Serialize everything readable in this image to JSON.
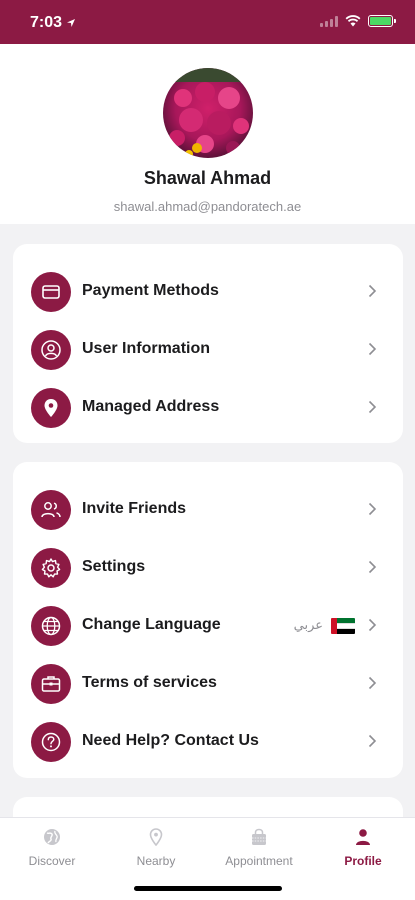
{
  "status_bar": {
    "time": "7:03"
  },
  "profile": {
    "name": "Shawal Ahmad",
    "email": "shawal.ahmad@pandoratech.ae"
  },
  "menu_group_1": [
    {
      "label": "Payment Methods",
      "icon": "credit-card-icon"
    },
    {
      "label": "User Information",
      "icon": "user-icon"
    },
    {
      "label": "Managed Address",
      "icon": "location-pin-icon"
    }
  ],
  "menu_group_2": [
    {
      "label": "Invite Friends",
      "icon": "users-icon"
    },
    {
      "label": "Settings",
      "icon": "gear-icon"
    },
    {
      "label": "Change Language",
      "icon": "globe-icon",
      "value": "عربي",
      "flag": "uae-flag-icon"
    },
    {
      "label": "Terms of services",
      "icon": "briefcase-icon"
    },
    {
      "label": "Need Help? Contact Us",
      "icon": "help-icon"
    }
  ],
  "tabs": [
    {
      "label": "Discover",
      "icon": "globe-icon",
      "active": false
    },
    {
      "label": "Nearby",
      "icon": "location-pin-icon",
      "active": false
    },
    {
      "label": "Appointment",
      "icon": "shopping-bag-icon",
      "active": false
    },
    {
      "label": "Profile",
      "icon": "person-icon",
      "active": true
    }
  ],
  "colors": {
    "brand": "#8c1a44",
    "background": "#f2f2f4",
    "inactive_tab": "#8e8e93"
  }
}
